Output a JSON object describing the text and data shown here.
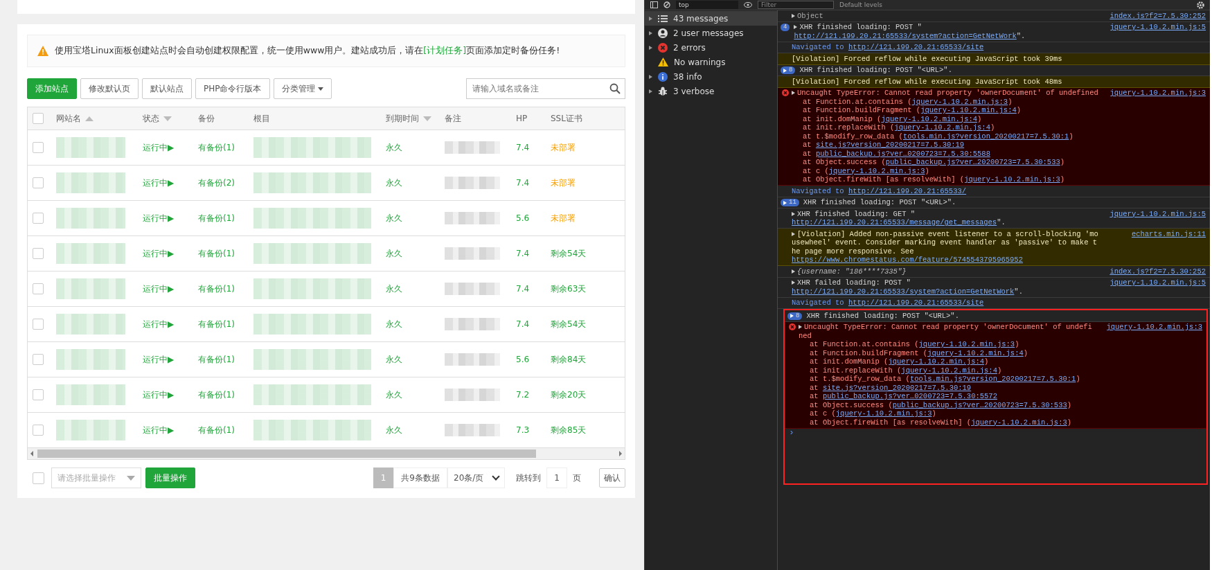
{
  "site_panel": {
    "notice": {
      "text_before": "使用宝塔Linux面板创建站点时会自动创建权限配置，统一使用www用户。建站成功后，请在",
      "link": "[计划任务]",
      "text_after": "页面添加定时备份任务!"
    },
    "toolbar": {
      "buttons": [
        {
          "label": "添加站点",
          "kind": "primary"
        },
        {
          "label": "修改默认页",
          "kind": "default"
        },
        {
          "label": "默认站点",
          "kind": "default"
        },
        {
          "label": "PHP命令行版本",
          "kind": "default"
        },
        {
          "label": "分类管理",
          "kind": "dropdown"
        }
      ],
      "search": {
        "placeholder": "请输入域名或备注"
      }
    },
    "table": {
      "select_all_checked": false,
      "columns": [
        {
          "label": "网站名",
          "kind": "ascending"
        },
        {
          "label": "状态",
          "kind": "descending"
        },
        {
          "label": "备份",
          "kind": "plain"
        },
        {
          "label": "根目",
          "kind": "plain"
        },
        {
          "label": "到期时间",
          "kind": "descending"
        },
        {
          "label": "备注",
          "kind": "plain"
        },
        {
          "label": "HP",
          "kind": "plain"
        },
        {
          "label": "SSL证书",
          "kind": "plain"
        }
      ],
      "rows": [
        {
          "checked": false,
          "status": "运行中▶",
          "backup": "有备份(1)",
          "expiry": "永久",
          "php": "7.4",
          "ssl": "未部署",
          "ssl_deployed": false
        },
        {
          "checked": false,
          "status": "运行中▶",
          "backup": "有备份(2)",
          "expiry": "永久",
          "php": "7.4",
          "ssl": "未部署",
          "ssl_deployed": false
        },
        {
          "checked": false,
          "status": "运行中▶",
          "backup": "有备份(1)",
          "expiry": "永久",
          "php": "5.6",
          "ssl": "未部署",
          "ssl_deployed": false
        },
        {
          "checked": false,
          "status": "运行中▶",
          "backup": "有备份(1)",
          "expiry": "永久",
          "php": "7.4",
          "ssl": "剩余54天",
          "ssl_deployed": true
        },
        {
          "checked": false,
          "status": "运行中▶",
          "backup": "有备份(1)",
          "expiry": "永久",
          "php": "7.4",
          "ssl": "剩余63天",
          "ssl_deployed": true
        },
        {
          "checked": false,
          "status": "运行中▶",
          "backup": "有备份(1)",
          "expiry": "永久",
          "php": "7.4",
          "ssl": "剩余54天",
          "ssl_deployed": true
        },
        {
          "checked": false,
          "status": "运行中▶",
          "backup": "有备份(1)",
          "expiry": "永久",
          "php": "5.6",
          "ssl": "剩余84天",
          "ssl_deployed": true
        },
        {
          "checked": false,
          "status": "运行中▶",
          "backup": "有备份(1)",
          "expiry": "永久",
          "php": "7.2",
          "ssl": "剩余20天",
          "ssl_deployed": true
        },
        {
          "checked": false,
          "status": "运行中▶",
          "backup": "有备份(1)",
          "expiry": "永久",
          "php": "7.3",
          "ssl": "剩余85天",
          "ssl_deployed": true
        }
      ]
    },
    "footer": {
      "select_all_checked": false,
      "batch_select": {
        "placeholder": "请选择批量操作"
      },
      "batch_button": "批量操作",
      "pages": [
        {
          "label": "1",
          "selected": true
        }
      ],
      "total": "共9条数据",
      "page_size": "20条/页",
      "jump_label": "跳转到",
      "jump_value": "1",
      "page_unit": "页",
      "confirm": "确认"
    }
  },
  "devtools": {
    "toolbar": {
      "context": "top",
      "filter_placeholder": "Filter",
      "levels": "Default levels"
    },
    "sidebar": [
      {
        "label": "43 messages",
        "kind": "messages",
        "expandable": true,
        "selected": true
      },
      {
        "label": "2 user messages",
        "kind": "user",
        "expandable": true,
        "selected": false
      },
      {
        "label": "2 errors",
        "kind": "error",
        "expandable": true,
        "selected": false
      },
      {
        "label": "No warnings",
        "kind": "warning",
        "expandable": false,
        "selected": false
      },
      {
        "label": "38 info",
        "kind": "info",
        "expandable": true,
        "selected": false
      },
      {
        "label": "3 verbose",
        "kind": "verbose",
        "expandable": true,
        "selected": false
      }
    ],
    "console": {
      "messages": [
        {
          "kind": "object",
          "expandable": true,
          "text": "Object",
          "source": "index.js?f2=7.5.30:252"
        },
        {
          "kind": "xhr",
          "badge": "4",
          "arrow_in_badge": false,
          "expandable": true,
          "text": "XHR finished loading: POST \"",
          "link": "http://121.199.20.21:65533/system?action=GetNetWork",
          "after": "\".",
          "source": "jquery-1.10.2.min.js:5"
        },
        {
          "kind": "nav",
          "text": "Navigated to ",
          "link": "http://121.199.20.21:65533/site"
        },
        {
          "kind": "violation",
          "text": "[Violation] Forced reflow while executing JavaScript took 39ms"
        },
        {
          "kind": "xhr",
          "badge": "8",
          "arrow_in_badge": true,
          "text": "XHR finished loading: POST \"<URL>\"."
        },
        {
          "kind": "violation",
          "text": "[Violation] Forced reflow while executing JavaScript took 48ms"
        },
        {
          "kind": "error",
          "expandable": true,
          "text": "Uncaught TypeError: Cannot read property 'ownerDocument' of undefined",
          "source": "jquery-1.10.2.min.js:3",
          "stack": [
            {
              "before": "at Function.at.contains (",
              "link": "jquery-1.10.2.min.js:3",
              "after": ")"
            },
            {
              "before": "at Function.buildFragment (",
              "link": "jquery-1.10.2.min.js:4",
              "after": ")"
            },
            {
              "before": "at init.domManip (",
              "link": "jquery-1.10.2.min.js:4",
              "after": ")"
            },
            {
              "before": "at init.replaceWith (",
              "link": "jquery-1.10.2.min.js:4",
              "after": ")"
            },
            {
              "before": "at t.$modify_row_data (",
              "link": "tools.min.js?version_20200217=7.5.30:1",
              "after": ")"
            },
            {
              "before": "at ",
              "link": "site.js?version_20200217=7.5.30:19"
            },
            {
              "before": "at ",
              "link": "public_backup.js?ver…0200723=7.5.30:5588"
            },
            {
              "before": "at Object.success (",
              "link": "public_backup.js?ver…20200723=7.5.30:533",
              "after": ")"
            },
            {
              "before": "at c (",
              "link": "jquery-1.10.2.min.js:3",
              "after": ")"
            },
            {
              "before": "at Object.fireWith [as resolveWith] (",
              "link": "jquery-1.10.2.min.js:3",
              "after": ")"
            }
          ]
        },
        {
          "kind": "nav",
          "text": "Navigated to ",
          "link": "http://121.199.20.21:65533/"
        },
        {
          "kind": "xhr",
          "badge": "11",
          "arrow_in_badge": true,
          "text": "XHR finished loading: POST \"<URL>\"."
        },
        {
          "kind": "xhr",
          "expandable": true,
          "text": "XHR finished loading: GET \"",
          "link": "http://121.199.20.21:65533/message/get_messages",
          "after": "\".",
          "source": "jquery-1.10.2.min.js:5"
        },
        {
          "kind": "violation",
          "expandable": true,
          "text": "[Violation] Added non-passive event listener to a scroll-blocking 'mousewheel' event. Consider marking event handler as 'passive' to make the page more responsive. See ",
          "link": "https://www.chromestatus.com/feature/5745543795965952",
          "source": "echarts.min.js:11"
        },
        {
          "kind": "value",
          "expandable": true,
          "text": "{username: \"186****7335\"}",
          "source": "index.js?f2=7.5.30:252"
        },
        {
          "kind": "xhr",
          "expandable": true,
          "text": "XHR failed loading: POST \"",
          "link": "http://121.199.20.21:65533/system?action=GetNetWork",
          "after": "\".",
          "source": "jquery-1.10.2.min.js:5"
        },
        {
          "kind": "nav",
          "text": "Navigated to ",
          "link": "http://121.199.20.21:65533/site"
        }
      ],
      "highlighted": {
        "messages": [
          {
            "kind": "xhr",
            "badge": "8",
            "arrow_in_badge": true,
            "text": "XHR finished loading: POST \"<URL>\"."
          },
          {
            "kind": "error",
            "expandable": true,
            "text": "Uncaught TypeError: Cannot read property 'ownerDocument' of undefined",
            "source": "jquery-1.10.2.min.js:3",
            "stack": [
              {
                "before": "at Function.at.contains (",
                "link": "jquery-1.10.2.min.js:3",
                "after": ")"
              },
              {
                "before": "at Function.buildFragment (",
                "link": "jquery-1.10.2.min.js:4",
                "after": ")"
              },
              {
                "before": "at init.domManip (",
                "link": "jquery-1.10.2.min.js:4",
                "after": ")"
              },
              {
                "before": "at init.replaceWith (",
                "link": "jquery-1.10.2.min.js:4",
                "after": ")"
              },
              {
                "before": "at t.$modify_row_data (",
                "link": "tools.min.js?version_20200217=7.5.30:1",
                "after": ")"
              },
              {
                "before": "at ",
                "link": "site.js?version_20200217=7.5.30:19"
              },
              {
                "before": "at ",
                "link": "public_backup.js?ver…0200723=7.5.30:5572"
              },
              {
                "before": "at Object.success (",
                "link": "public_backup.js?ver…20200723=7.5.30:533",
                "after": ")"
              },
              {
                "before": "at c (",
                "link": "jquery-1.10.2.min.js:3",
                "after": ")"
              },
              {
                "before": "at Object.fireWith [as resolveWith] (",
                "link": "jquery-1.10.2.min.js:3",
                "after": ")"
              }
            ]
          }
        ],
        "prompt": "›"
      }
    }
  }
}
